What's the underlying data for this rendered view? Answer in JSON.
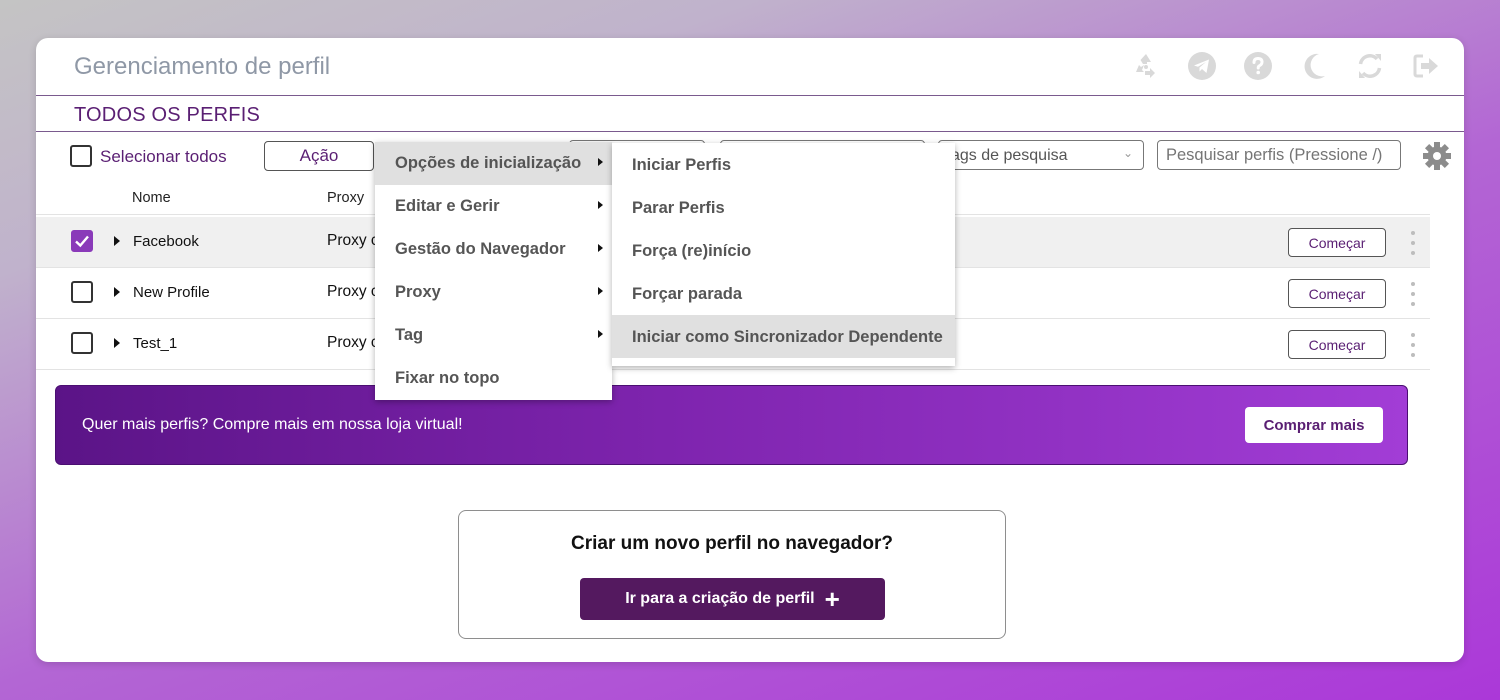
{
  "app": {
    "title": "Gerenciamento de perfil"
  },
  "header_icons": [
    "recycle-icon",
    "telegram-icon",
    "help-icon",
    "moon-icon",
    "sync-icon",
    "logout-icon"
  ],
  "section": {
    "title": "TODOS OS PERFIS"
  },
  "toolbar": {
    "select_all_label": "Selecionar todos",
    "action_label": "Ação",
    "tags_placeholder": "Tags de pesquisa",
    "tags_visible": "ags de pesquisa",
    "search_placeholder": "Pesquisar perfis (Pressione /)"
  },
  "columns": {
    "name": "Nome",
    "proxy": "Proxy"
  },
  "profiles": [
    {
      "name": "Facebook",
      "proxy": "Proxy c",
      "checked": true,
      "start_label": "Começar"
    },
    {
      "name": "New Profile",
      "proxy": "Proxy c",
      "checked": false,
      "start_label": "Começar"
    },
    {
      "name": "Test_1",
      "proxy": "Proxy c",
      "checked": false,
      "start_label": "Começar"
    }
  ],
  "promo": {
    "text": "Quer mais perfis? Compre mais em nossa loja virtual!",
    "button_label": "Comprar mais"
  },
  "create": {
    "title": "Criar um novo perfil no navegador?",
    "button_label": "Ir para a criação de perfil"
  },
  "context_menu": {
    "items": [
      {
        "label": "Opções de inicialização",
        "has_submenu": true,
        "active": true
      },
      {
        "label": "Editar e Gerir",
        "has_submenu": true
      },
      {
        "label": "Gestão do Navegador",
        "has_submenu": true
      },
      {
        "label": "Proxy",
        "has_submenu": true
      },
      {
        "label": "Tag",
        "has_submenu": true
      },
      {
        "label": "Fixar no topo",
        "has_submenu": false
      }
    ]
  },
  "submenu": {
    "items": [
      {
        "label": "Iniciar Perfis"
      },
      {
        "label": "Parar Perfis"
      },
      {
        "label": "Força (re)início"
      },
      {
        "label": "Forçar parada"
      },
      {
        "label": "Iniciar como Sincronizador Dependente",
        "active": true
      }
    ]
  },
  "colors": {
    "brand": "#5a1f73",
    "accent": "#8a3ab9",
    "button_dark": "#54195f"
  }
}
